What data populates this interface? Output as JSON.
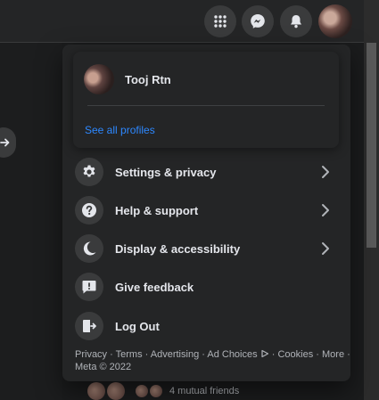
{
  "profile": {
    "name": "Tooj Rtn",
    "see_all": "See all profiles"
  },
  "menu_items": [
    {
      "label": "Settings & privacy",
      "icon": "gear-icon",
      "has_chevron": true
    },
    {
      "label": "Help & support",
      "icon": "question-icon",
      "has_chevron": true
    },
    {
      "label": "Display & accessibility",
      "icon": "moon-icon",
      "has_chevron": true
    },
    {
      "label": "Give feedback",
      "icon": "feedback-icon",
      "has_chevron": false
    },
    {
      "label": "Log Out",
      "icon": "logout-icon",
      "has_chevron": false
    }
  ],
  "footer": {
    "links": [
      "Privacy",
      "Terms",
      "Advertising",
      "Ad Choices",
      "Cookies",
      "More"
    ],
    "separator": " · ",
    "copyright": "Meta © 2022"
  },
  "background": {
    "mutual_friends": "4 mutual friends"
  },
  "colors": {
    "link": "#2d88ff",
    "menu_bg": "#242526",
    "icon_bg": "#3a3b3c"
  }
}
